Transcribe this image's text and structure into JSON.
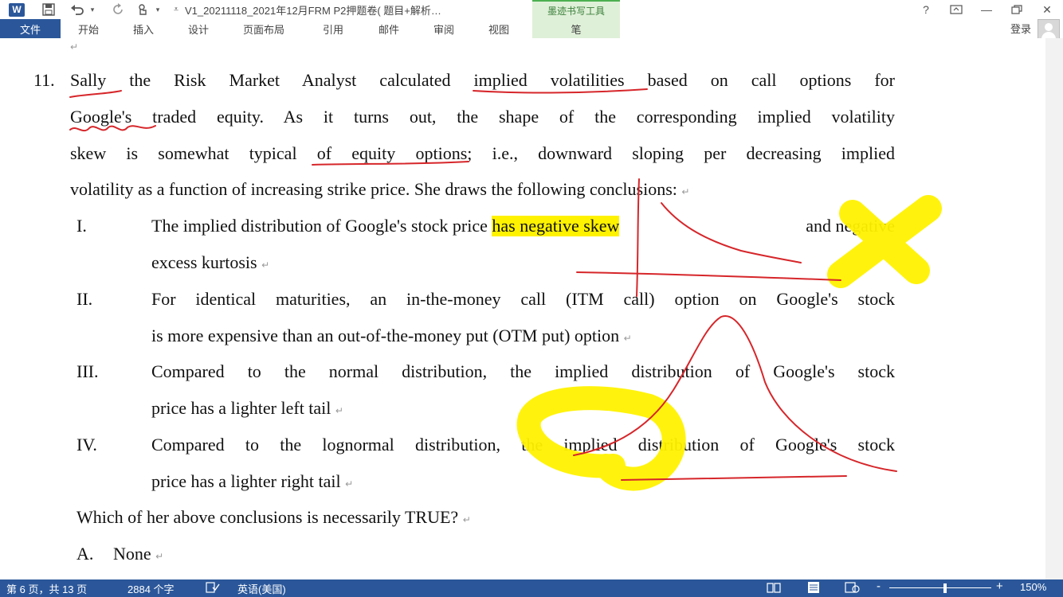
{
  "titlebar": {
    "doc_title": "V1_20211118_2021年12月FRM P2押题卷( 题目+解析…",
    "contextual_tab_group": "墨迹书写工具",
    "help_glyph": "?",
    "ribbon_display_glyph": "⊡",
    "minimize_glyph": "—",
    "restore_glyph": "🗗",
    "close_glyph": "✕"
  },
  "ribbon": {
    "file_tab": "文件",
    "tabs": [
      "开始",
      "插入",
      "设计",
      "页面布局",
      "引用",
      "邮件",
      "审阅",
      "视图"
    ],
    "pen_tab": "笔",
    "login": "登录"
  },
  "document": {
    "question_number": "11.",
    "stem_line1": "Sally the Risk Market Analyst calculated implied volatilities based on call options for",
    "stem_line2": "Google's traded equity. As it turns out, the shape of the corresponding implied volatility",
    "stem_line3": "skew is somewhat typical of equity options; i.e., downward sloping per decreasing implied",
    "stem_line4": "volatility as a function of increasing strike price. She draws the following conclusions:",
    "items": [
      {
        "numeral": "I.",
        "line1_before": "The implied distribution of Google's stock price ",
        "line1_highlight": "has negative skew",
        "line1_after": " and negative",
        "line2": "excess kurtosis"
      },
      {
        "numeral": "II.",
        "line1": "For identical maturities, an in-the-money call (ITM call) option on Google's stock",
        "line2": "is more expensive than an out-of-the-money put (OTM put) option"
      },
      {
        "numeral": "III.",
        "line1": "Compared to the normal distribution, the implied distribution of Google's stock",
        "line2": "price has a lighter left tail"
      },
      {
        "numeral": "IV.",
        "line1": "Compared to the lognormal distribution, the implied distribution of Google's stock",
        "line2": "price has a lighter right tail"
      }
    ],
    "question": "Which of her above conclusions is necessarily TRUE?",
    "option_a_letter": "A.",
    "option_a_text": "None",
    "paragraph_mark": "↵"
  },
  "statusbar": {
    "page_info": "第 6 页，共 13 页",
    "word_count": "2884 个字",
    "language": "英语(美国)",
    "zoom": "150%",
    "zoom_level_fraction": 0.55,
    "zoom_minus": "-",
    "zoom_plus": "+"
  },
  "colors": {
    "accent": "#2b579a",
    "ink_red": "#d6262a",
    "ink_yellow": "#fff200",
    "highlight": "#fff200"
  },
  "icons": [
    "word-app-icon",
    "save-icon",
    "undo-icon",
    "redo-icon",
    "touch-mode-icon",
    "customize-qat-icon",
    "proofing-icon",
    "read-mode-icon",
    "print-layout-icon",
    "web-layout-icon"
  ]
}
